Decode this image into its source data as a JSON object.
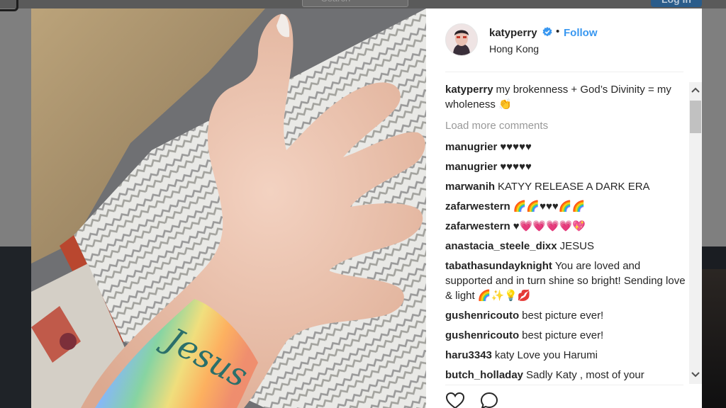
{
  "background": {
    "search_placeholder": "Search",
    "login_label": "Log In"
  },
  "post": {
    "username": "katyperry",
    "separator": "•",
    "follow_label": "Follow",
    "location": "Hong Kong",
    "caption": {
      "username": "katyperry",
      "text": "my brokenness + God’s Divinity = my wholeness 👏"
    },
    "load_more_label": "Load more comments",
    "comments": [
      {
        "username": "manugrier",
        "text": "♥♥♥♥♥"
      },
      {
        "username": "manugrier",
        "text": "♥♥♥♥♥"
      },
      {
        "username": "marwanih",
        "text": "KATYY RELEASE A DARK ERA"
      },
      {
        "username": "zafarwestern",
        "text": "🌈🌈♥♥♥🌈🌈"
      },
      {
        "username": "zafarwestern",
        "text": "♥💗💗💗💗💖"
      },
      {
        "username": "anastacia_steele_dixx",
        "text": "JESUS"
      },
      {
        "username": "tabathasundayknight",
        "text": "You are loved and supported and in turn shine so bright! Sending love & light 🌈✨💡💋"
      },
      {
        "username": "gushenricouto",
        "text": "best picture ever!"
      },
      {
        "username": "gushenricouto",
        "text": "best picture ever!"
      },
      {
        "username": "haru3343",
        "text": "katy Love you Harumi"
      },
      {
        "username": "butch_holladay",
        "text": "Sadly Katy , most of your"
      }
    ]
  },
  "icons": {
    "verified": "verified-badge-icon",
    "like": "heart-icon",
    "comment": "comment-bubble-icon",
    "scroll_up": "chevron-up-icon",
    "scroll_down": "chevron-down-icon"
  },
  "colors": {
    "follow": "#3897f0",
    "username_text": "#262626",
    "muted_text": "#999999",
    "overlay": "#7f7f7f"
  }
}
